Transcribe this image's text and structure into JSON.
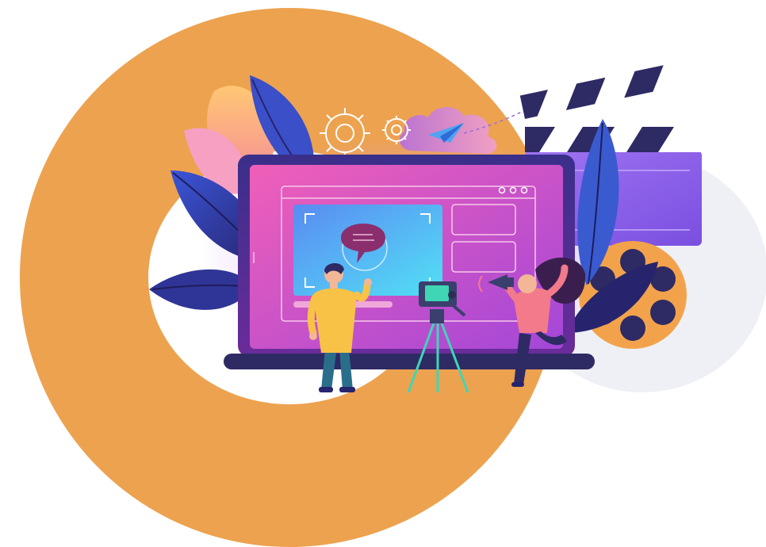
{
  "illustration": {
    "theme": "video-production",
    "colors": {
      "ring": "#EDA24F",
      "ring_inner_bg": "#FFFFFF",
      "gray_blob": "#EEF0F4",
      "laptop_bezel": "#5A2D8C",
      "laptop_screen": "#E55AB8",
      "laptop_base": "#2E2A64",
      "preview_window": "#4FB8F2",
      "speech_bubble": "#8A2E6E",
      "leaf_navy": "#2C2F82",
      "leaf_blue": "#3A5BD0",
      "leaf_peach": "#F8B37A",
      "leaf_pink": "#F6A0C2",
      "clapper_body": "#8B66E8",
      "clapper_stripe_dark": "#2E2A64",
      "film_reel": "#F3A24C",
      "tripod": "#3ED6B4",
      "camera": "#3A3F6E",
      "man_shirt": "#F8C247",
      "man_pants": "#2A6E8C",
      "woman_shirt": "#F27A8A",
      "woman_hair": "#3A1F4E",
      "gears": "#FFFFFF",
      "paper_plane": "#4FA3F0",
      "cloud": "#C48EE6"
    },
    "icons": [
      "gear-icon",
      "paper-plane-icon",
      "cloud-icon",
      "clapperboard-icon",
      "film-reel-icon",
      "video-camera-icon",
      "megaphone-icon",
      "speech-bubble-icon",
      "window-controls-icon"
    ]
  }
}
